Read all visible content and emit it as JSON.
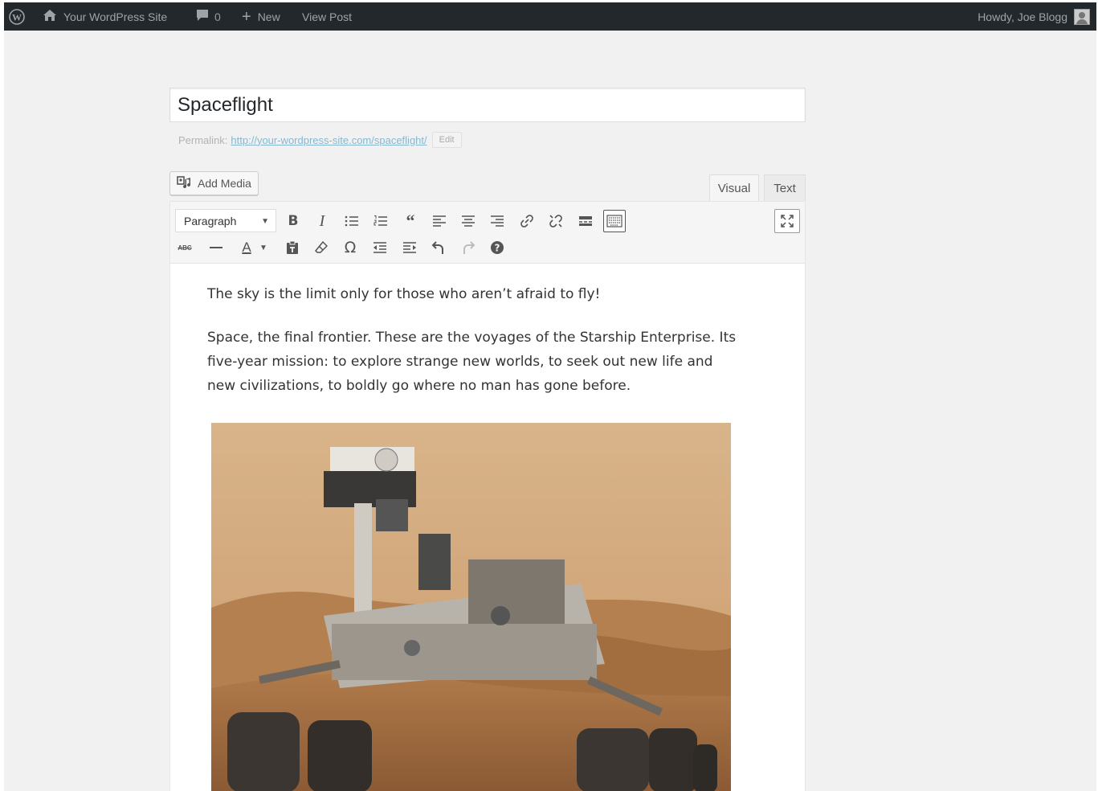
{
  "admin_bar": {
    "site_name": "Your WordPress Site",
    "comments_count": "0",
    "new_label": "New",
    "view_post_label": "View Post",
    "howdy": "Howdy, Joe Blogg"
  },
  "post": {
    "title": "Spaceflight",
    "permalink_label": "Permalink:",
    "permalink_url": "http://your-wordpress-site.com/spaceflight/",
    "edit_label": "Edit"
  },
  "add_media_label": "Add Media",
  "tabs": {
    "visual": "Visual",
    "text": "Text"
  },
  "toolbar": {
    "format_value": "Paragraph",
    "strike_label": "ABC",
    "text_color_label": "A"
  },
  "content": {
    "paragraph1": "The sky is the limit only for those who aren’t afraid to fly!",
    "paragraph2": "Space, the final frontier. These are the voyages of the Starship Enterprise. Its five-year mission: to explore strange new worlds, to seek out new life and new civilizations, to boldly go where no man has gone before."
  },
  "colors": {
    "admin_bar_bg": "#23282d",
    "page_bg": "#f1f1f1",
    "link": "#0073aa"
  }
}
